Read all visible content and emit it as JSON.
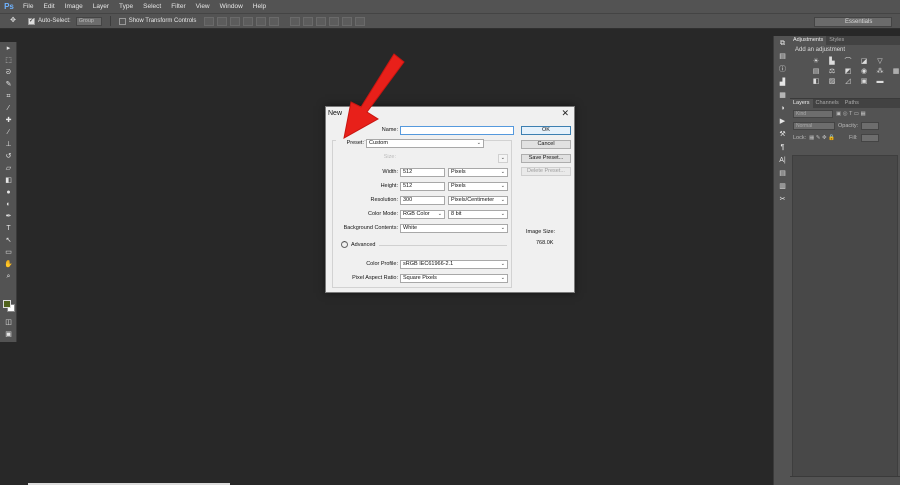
{
  "app": {
    "logo": "Ps"
  },
  "menu": [
    "File",
    "Edit",
    "Image",
    "Layer",
    "Type",
    "Select",
    "Filter",
    "View",
    "Window",
    "Help"
  ],
  "options_bar": {
    "move_tool_icon": "move-icon",
    "auto_select_label": "Auto-Select:",
    "auto_select_value": "Group",
    "transform_controls_label": "Show Transform Controls",
    "workspace": "Essentials"
  },
  "panels": {
    "top_tabs": [
      "Adjustments",
      "Styles"
    ],
    "adjustments_title": "Add an adjustment",
    "layer_tabs": [
      "Layers",
      "Channels",
      "Paths"
    ],
    "kind_label": "Kind",
    "blend_mode": "Normal",
    "opacity_label": "Opacity:",
    "lock_label": "Lock:",
    "fill_label": "Fill:"
  },
  "colors": {
    "foreground": "#50621c",
    "background": "#ffffff",
    "arrow": "#e8201a"
  },
  "dialog": {
    "title": "New",
    "name_label": "Name:",
    "name_value": "",
    "preset_label": "Preset:",
    "preset_value": "Custom",
    "size_label": "Size:",
    "size_value": "",
    "width_label": "Width:",
    "width_value": "512",
    "width_unit": "Pixels",
    "height_label": "Height:",
    "height_value": "512",
    "height_unit": "Pixels",
    "resolution_label": "Resolution:",
    "resolution_value": "300",
    "resolution_unit": "Pixels/Centimeter",
    "color_mode_label": "Color Mode:",
    "color_mode_value": "RGB Color",
    "bit_depth_value": "8 bit",
    "background_label": "Background Contents:",
    "background_value": "White",
    "advanced_label": "Advanced",
    "color_profile_label": "Color Profile:",
    "color_profile_value": "sRGB IEC61966-2.1",
    "pixel_aspect_label": "Pixel Aspect Ratio:",
    "pixel_aspect_value": "Square Pixels",
    "buttons": {
      "ok": "OK",
      "cancel": "Cancel",
      "save_preset": "Save Preset...",
      "delete_preset": "Delete Preset..."
    },
    "image_size_label": "Image Size:",
    "image_size_value": "768.0K"
  }
}
